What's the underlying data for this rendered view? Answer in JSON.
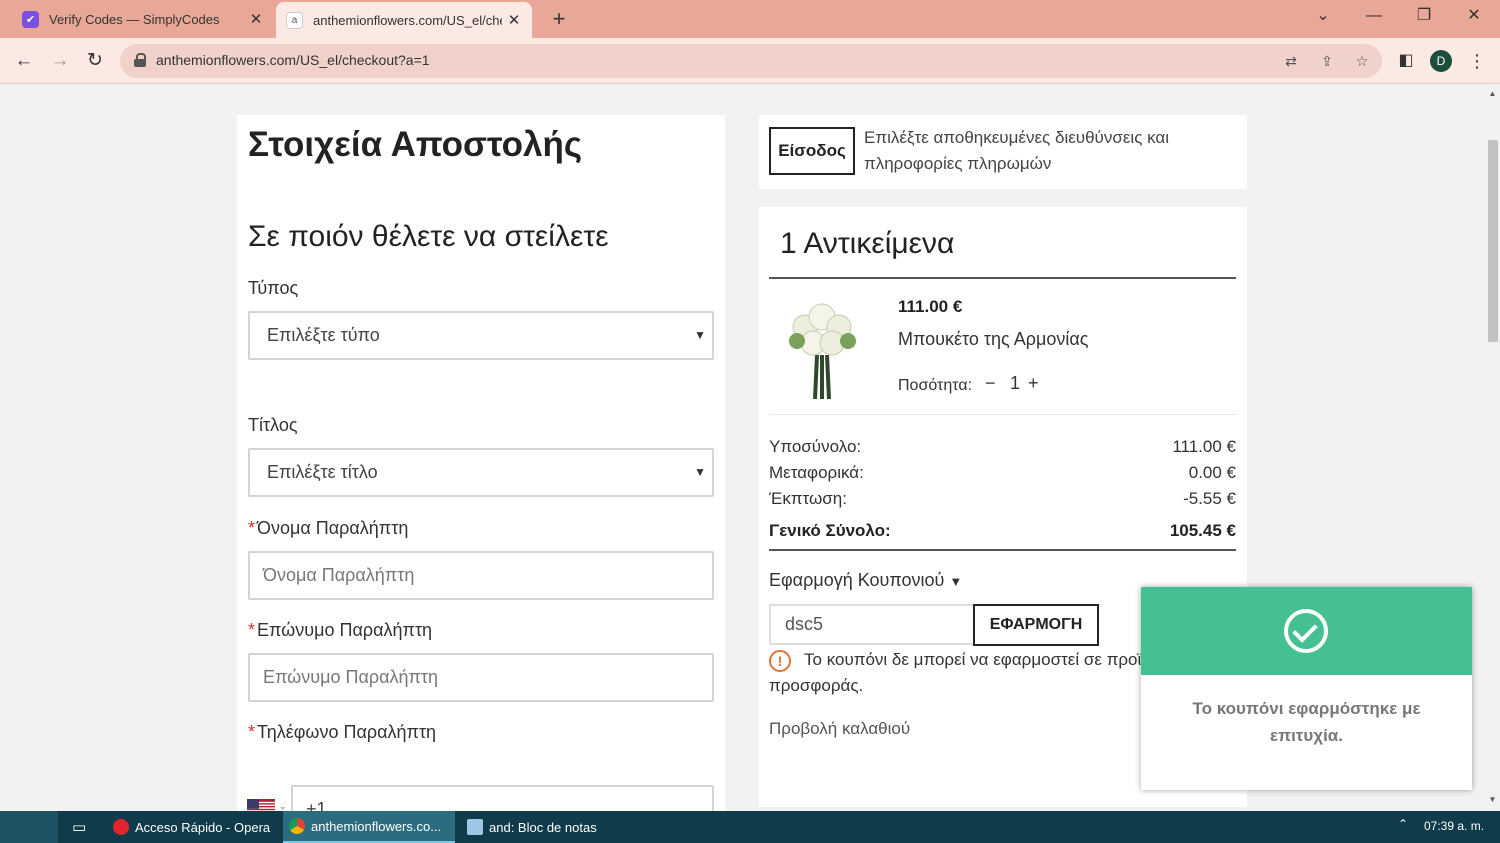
{
  "browser": {
    "tabs": [
      {
        "title": "Verify Codes — SimplyCodes",
        "icon": "simplycodes-icon"
      },
      {
        "title": "anthemionflowers.com/US_el/che",
        "icon": "site-favicon"
      }
    ],
    "url": "anthemionflowers.com/US_el/checkout?a=1",
    "profile_initial": "D"
  },
  "left": {
    "page_title": "Στοιχεία Αποστολής",
    "section_title": "Σε ποιόν θέλετε να στείλετε",
    "type_label": "Τύπος",
    "type_select": "Επιλέξτε τύπο",
    "title_label": "Τίτλος",
    "title_select": "Επιλέξτε τίτλο",
    "required_mark": "*",
    "first_name_label": "Όνομα Παραλήπτη",
    "first_name_placeholder": "Όνομα Παραλήπτη",
    "last_name_label": "Επώνυμο Παραλήπτη",
    "last_name_placeholder": "Επώνυμο Παραλήπτη",
    "phone_label": "Τηλέφωνο Παραλήπτη",
    "phone_value": "+1"
  },
  "login": {
    "button": "Είσοδος",
    "text": "Επιλέξτε αποθηκευμένες διευθύνσεις και πληροφορίες πληρωμών"
  },
  "summary": {
    "title": "1 Αντικείμενα",
    "item": {
      "price": "111.00 €",
      "name": "Μπουκέτο της Αρμονίας",
      "qty_label": "Ποσότητα:",
      "qty": "1",
      "minus": "−",
      "plus": "+"
    },
    "rows": [
      {
        "label": "Υποσύνολο:",
        "value": "111.00 €"
      },
      {
        "label": "Μεταφορικά:",
        "value": "0.00 €"
      },
      {
        "label": "Έκπτωση:",
        "value": "-5.55 €"
      }
    ],
    "total": {
      "label": "Γενικό Σύνολο:",
      "value": "105.45 €"
    },
    "coupon_title": "Εφαρμογή Κουπονιού",
    "coupon_value": "dsc5",
    "coupon_button": "ΕΦΑΡΜΟΓΗ",
    "coupon_warning": "Το κουπόνι δε μπορεί να εφαρμοστεί σε προϊόντα προσφοράς.",
    "view_cart": "Προβολή καλαθιού"
  },
  "toast": {
    "message": "Το κουπόνι εφαρμόστηκε με επιτυχία.",
    "accent": "#45c093"
  },
  "taskbar": {
    "items": [
      {
        "label": "Acceso Rápido - Opera"
      },
      {
        "label": "anthemionflowers.co..."
      },
      {
        "label": "and: Bloc de notas"
      }
    ],
    "clock": "07:39 a. m."
  }
}
